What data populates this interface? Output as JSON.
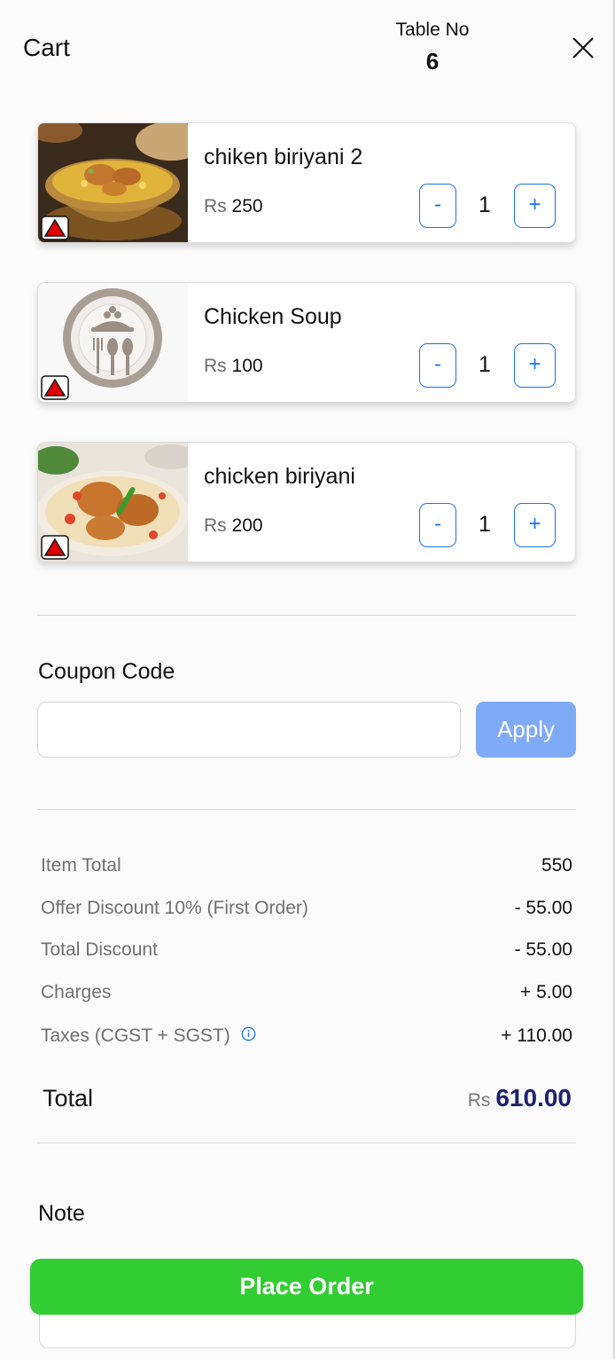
{
  "header": {
    "title": "Cart",
    "table_label": "Table No",
    "table_number": "6",
    "close_icon": "close-icon"
  },
  "items": [
    {
      "name": "chiken biriyani 2",
      "currency": "Rs",
      "price": "250",
      "quantity": "1",
      "minus_label": "-",
      "plus_label": "+",
      "image": "biriyani-bowl-photo",
      "badge": "non-veg-icon"
    },
    {
      "name": "Chicken Soup",
      "currency": "Rs",
      "price": "100",
      "quantity": "1",
      "minus_label": "-",
      "plus_label": "+",
      "image": "placeholder-plate-icon",
      "badge": "non-veg-icon"
    },
    {
      "name": "chicken biriyani",
      "currency": "Rs",
      "price": "200",
      "quantity": "1",
      "minus_label": "-",
      "plus_label": "+",
      "image": "biriyani-plate-photo",
      "badge": "non-veg-icon"
    }
  ],
  "coupon": {
    "label": "Coupon Code",
    "value": "",
    "placeholder": "",
    "apply_label": "Apply"
  },
  "summary": {
    "rows": [
      {
        "label": "Item Total",
        "value": "550"
      },
      {
        "label": "Offer Discount 10% (First Order)",
        "value": "- 55.00"
      },
      {
        "label": "Total Discount",
        "value": "- 55.00"
      },
      {
        "label": "Charges",
        "value": "+ 5.00"
      },
      {
        "label": "Taxes (CGST + SGST)",
        "value": "+ 110.00"
      }
    ],
    "total_label": "Total",
    "total_currency": "Rs",
    "total_amount": "610.00"
  },
  "note": {
    "label": "Note",
    "value": ""
  },
  "place_order_label": "Place Order",
  "colors": {
    "accent_blue": "#1a73e8",
    "apply_button": "#7fabf6",
    "place_order": "#32cd32",
    "total_amount": "#1e2070",
    "non_veg_badge": "#e10000"
  }
}
